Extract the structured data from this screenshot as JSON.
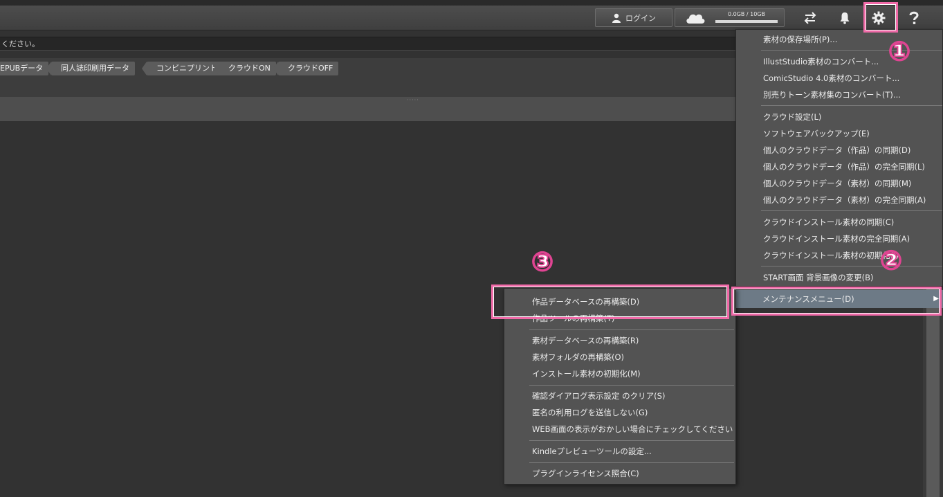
{
  "header": {
    "login_label": "ログイン",
    "cloud_usage": "0.0GB / 10GB",
    "icons": [
      "user-icon",
      "cloud-icon",
      "sync-icon",
      "bell-icon",
      "gear-icon",
      "help-icon"
    ]
  },
  "message": "ください。",
  "tags": [
    "EPUBデータ",
    "同人誌印刷用データ",
    "コンビニプリント",
    "クラウドON",
    "クラウドOFF"
  ],
  "settings_menu": {
    "groups": [
      [
        "素材の保存場所(P)..."
      ],
      [
        "IllustStudio素材のコンバート...",
        "ComicStudio 4.0素材のコンバート...",
        "別売りトーン素材集のコンバート(T)..."
      ],
      [
        "クラウド設定(L)",
        "ソフトウェアバックアップ(E)",
        "個人のクラウドデータ（作品）の同期(D)",
        "個人のクラウドデータ（作品）の完全同期(L)",
        "個人のクラウドデータ（素材）の同期(M)",
        "個人のクラウドデータ（素材）の完全同期(A)"
      ],
      [
        "クラウドインストール素材の同期(C)",
        "クラウドインストール素材の完全同期(A)",
        "クラウドインストール素材の初期化(I)"
      ],
      [
        "START画面 背景画像の変更(B)"
      ]
    ],
    "maintenance_label": "メンテナンスメニュー(D)"
  },
  "maintenance_menu": {
    "groups": [
      [
        "作品データベースの再構築(D)",
        "作品ツールの再構築(T)"
      ],
      [
        "素材データベースの再構築(R)",
        "素材フォルダの再構築(O)",
        "インストール素材の初期化(M)"
      ],
      [
        "確認ダイアログ表示設定 のクリア(S)",
        "匿名の利用ログを送信しない(G)",
        "WEB画面の表示がおかしい場合にチェックしてください"
      ],
      [
        "Kindleプレビューツールの設定..."
      ],
      [
        "プラグインライセンス照合(C)"
      ]
    ]
  },
  "annotations": [
    "①",
    "②",
    "③"
  ],
  "colors": {
    "highlight": "#f06aa8",
    "menu_bg": "#535353",
    "menu_selected": "#6d7a86"
  }
}
